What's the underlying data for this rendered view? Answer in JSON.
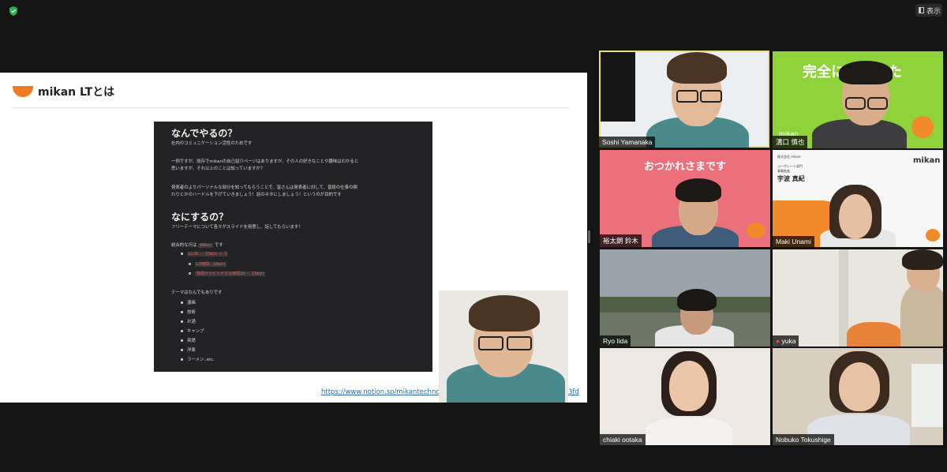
{
  "topbar": {
    "view_label": "表示"
  },
  "share": {
    "slide_title": "mikan LTとは",
    "doc": {
      "h1": "なんでやるの？",
      "p1": "社内のコミュニケーション活性のためです",
      "p2a": "一例ですが、既存でmikanの自己紹介ページはありますが、その人の好きなことや趣味はわかると",
      "p2b": "思いますが、それ以上のことは知っていますか？",
      "p3a": "発表者のよりパーソナルな部分を知ってもらうことで、皆さんは発表者に対して、普段の仕事の関",
      "p3b": "わりとかのハードルを下げていきましょう！話のネタにしましょう！というのが目的です",
      "h2": "なにするの？",
      "p4": "フリーテーマについて各々がスライドを用意し、話してもらいます！",
      "p5_prefix": "総合的な尺は",
      "p5_code": "60min",
      "p5_suffix": "です",
      "b1_code": "LLJR - 15min x 3",
      "b1a_code": "LT時間：10min",
      "b1b_code": "質問やツイツイする時間10 - 15min",
      "p6": "テーマはなんでもありです",
      "themes": [
        "漫画",
        "技術",
        "お酒",
        "キャンプ",
        "英語",
        "洋楽",
        "ラーメン..etc."
      ]
    },
    "link": "https://www.notion.so/mikantechnology/m",
    "link_tail": "3fd"
  },
  "gallery": [
    {
      "name": "Soshi Yamanaka",
      "active": true
    },
    {
      "name": "溝口 慎也",
      "bg_text": "完全に理解した",
      "brand": "mikan"
    },
    {
      "name": "裕太朗 鈴木",
      "bg_text": "おつかれさまです"
    },
    {
      "name": "Maki Unami",
      "brand": "mikan",
      "small1": "株式会社 mikan",
      "small2": "コーポレート部門",
      "small3": "事業推進",
      "jp_name": "宇波 真紀"
    },
    {
      "name": "Ryo Iida"
    },
    {
      "name": "yuka"
    },
    {
      "name": "chiaki ootaka"
    },
    {
      "name": "Nobuko Tokushige"
    }
  ],
  "colors": {
    "accent": "#e6e07a",
    "mikan_orange": "#f07a24",
    "lime": "#8fd23a",
    "pink": "#ec6f7c"
  }
}
